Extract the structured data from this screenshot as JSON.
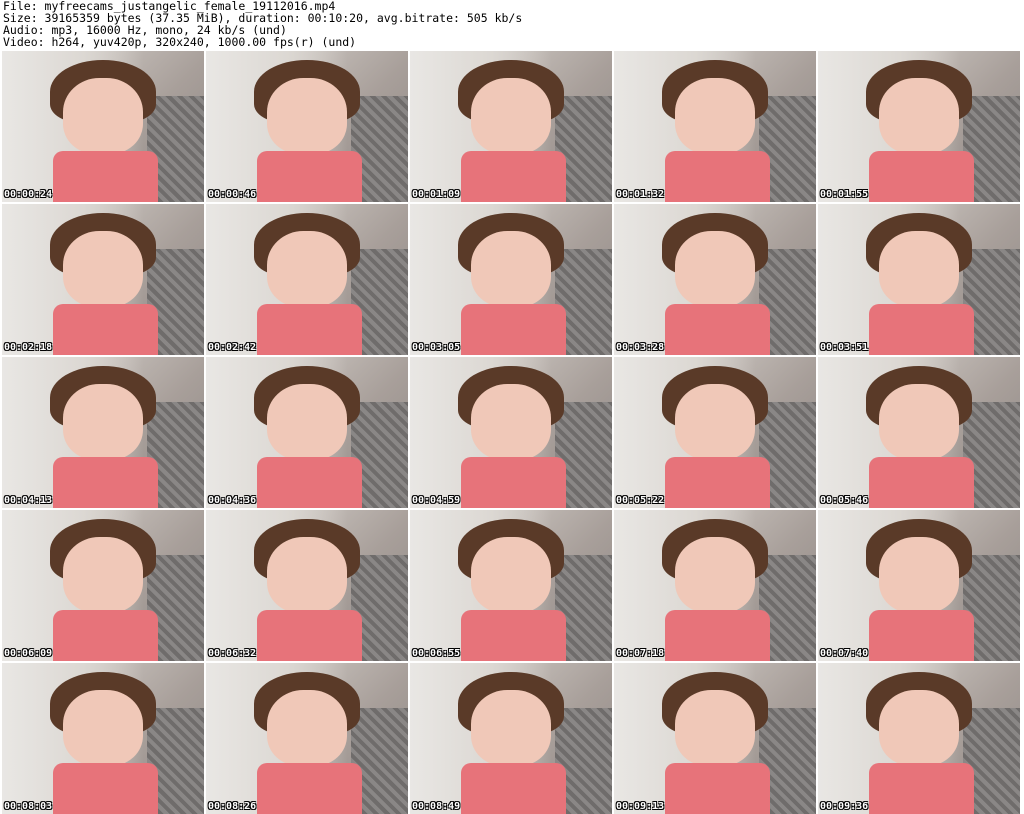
{
  "header": {
    "file_line": "File: myfreecams_justangelic_female_19112016.mp4",
    "size_line": "Size: 39165359 bytes (37.35 MiB), duration: 00:10:20, avg.bitrate: 505 kb/s",
    "audio_line": "Audio: mp3, 16000 Hz, mono, 24 kb/s (und)",
    "video_line": "Video: h264, yuv420p, 320x240, 1000.00 fps(r) (und)"
  },
  "thumbnails": [
    {
      "timestamp": "00:00:24"
    },
    {
      "timestamp": "00:00:46"
    },
    {
      "timestamp": "00:01:09"
    },
    {
      "timestamp": "00:01:32"
    },
    {
      "timestamp": "00:01:55"
    },
    {
      "timestamp": "00:02:18"
    },
    {
      "timestamp": "00:02:42"
    },
    {
      "timestamp": "00:03:05"
    },
    {
      "timestamp": "00:03:28"
    },
    {
      "timestamp": "00:03:51"
    },
    {
      "timestamp": "00:04:13"
    },
    {
      "timestamp": "00:04:36"
    },
    {
      "timestamp": "00:04:59"
    },
    {
      "timestamp": "00:05:22"
    },
    {
      "timestamp": "00:05:46"
    },
    {
      "timestamp": "00:06:09"
    },
    {
      "timestamp": "00:06:32"
    },
    {
      "timestamp": "00:06:55"
    },
    {
      "timestamp": "00:07:18"
    },
    {
      "timestamp": "00:07:40"
    },
    {
      "timestamp": "00:08:03"
    },
    {
      "timestamp": "00:08:26"
    },
    {
      "timestamp": "00:08:49"
    },
    {
      "timestamp": "00:09:13"
    },
    {
      "timestamp": "00:09:36"
    }
  ]
}
